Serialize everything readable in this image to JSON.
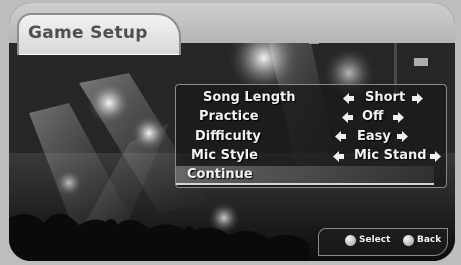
{
  "header": {
    "title": "Game Setup"
  },
  "menu": {
    "options": [
      {
        "label": "Song Length",
        "value": "Short"
      },
      {
        "label": "Practice",
        "value": "Off"
      },
      {
        "label": "Difficulty",
        "value": "Easy"
      },
      {
        "label": "Mic Style",
        "value": "Mic Stand"
      }
    ],
    "continue_label": "Continue"
  },
  "footer": {
    "select_label": "Select",
    "back_label": "Back"
  },
  "colors": {
    "panel_border": "#8a8a8a",
    "text": "#f2f2f2",
    "title_text": "#505050",
    "frame": "#bdbdbd"
  },
  "icons": {
    "left": "arrow-left-icon",
    "right": "arrow-right-icon",
    "button": "controller-button-icon"
  }
}
